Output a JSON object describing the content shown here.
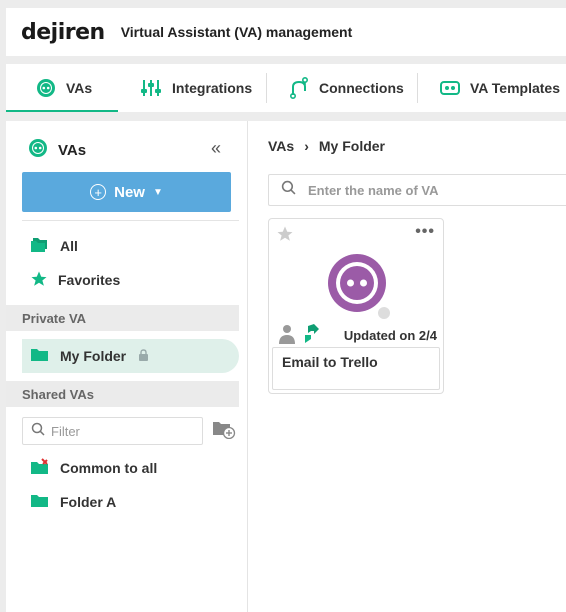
{
  "header": {
    "logo": "dejiren",
    "title": "Virtual Assistant (VA) management"
  },
  "tabs": [
    {
      "label": "VAs",
      "icon": "va-face-icon",
      "active": true
    },
    {
      "label": "Integrations",
      "icon": "sliders-icon",
      "active": false
    },
    {
      "label": "Connections",
      "icon": "connection-icon",
      "active": false
    },
    {
      "label": "VA Templates",
      "icon": "template-icon",
      "active": false
    }
  ],
  "sidebar": {
    "title": "VAs",
    "new_button": "New",
    "all": "All",
    "favorites": "Favorites",
    "private_section": "Private VA",
    "my_folder": "My Folder",
    "shared_section": "Shared VAs",
    "filter_placeholder": "Filter",
    "common": "Common to all",
    "folder_a": "Folder A"
  },
  "main": {
    "breadcrumb": [
      "VAs",
      "›",
      "My Folder"
    ],
    "search_placeholder": "Enter the name of VA",
    "card": {
      "updated": "Updated on 2/4",
      "name": "Email to Trello"
    }
  },
  "colors": {
    "accent": "#12b886",
    "button": "#5aa9dd",
    "avatar": "#9b5ba7"
  }
}
